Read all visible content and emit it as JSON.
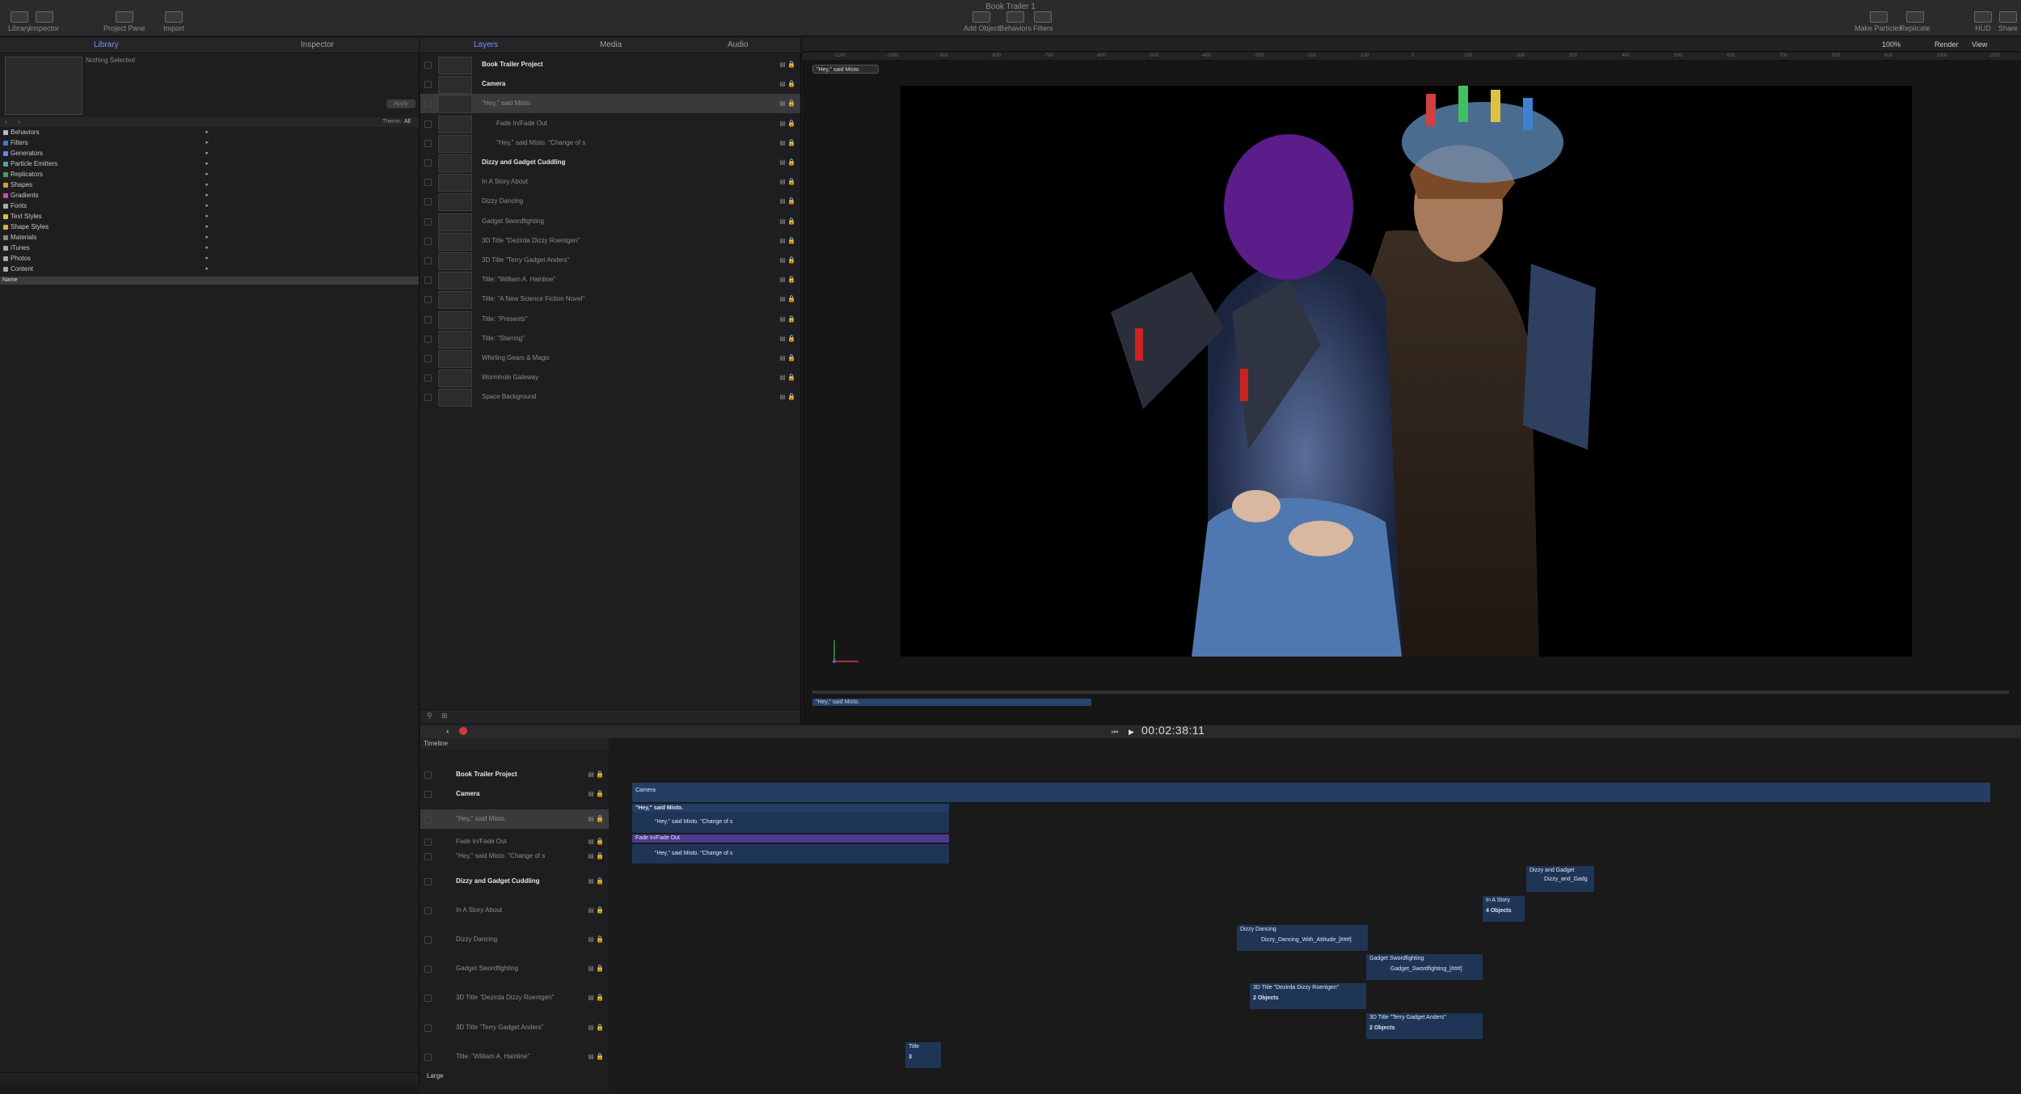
{
  "window": {
    "title": "Book Trailer 1"
  },
  "toolbar": {
    "left": [
      "Library",
      "Inspector",
      "Project Pane",
      "Import"
    ],
    "center": [
      "Add Object",
      "Behaviors",
      "Filters"
    ],
    "right": [
      "Make Particles",
      "Replicate",
      "HUD",
      "Share"
    ]
  },
  "left_tabs": {
    "library": "Library",
    "inspector": "Inspector"
  },
  "library": {
    "nothing_selected": "Nothing Selected",
    "apply": "Apply",
    "theme_label": "Theme:",
    "theme_value": "All",
    "categories": [
      {
        "label": "Behaviors",
        "color": "#bbbbbb"
      },
      {
        "label": "Filters",
        "color": "#3d7bd9"
      },
      {
        "label": "Generators",
        "color": "#5c8fe0"
      },
      {
        "label": "Particle Emitters",
        "color": "#4fa3a8"
      },
      {
        "label": "Replicators",
        "color": "#4a9c5a"
      },
      {
        "label": "Shapes",
        "color": "#d99a3d"
      },
      {
        "label": "Gradients",
        "color": "#c24cb1"
      },
      {
        "label": "Fonts",
        "color": "#aaaaaa"
      },
      {
        "label": "Text Styles",
        "color": "#d9c23d"
      },
      {
        "label": "Shape Styles",
        "color": "#d9b23d"
      },
      {
        "label": "Materials",
        "color": "#888888"
      },
      {
        "label": "iTunes",
        "color": "#aaaaaa"
      },
      {
        "label": "Photos",
        "color": "#aaaaaa"
      },
      {
        "label": "Content",
        "color": "#aaaaaa"
      }
    ],
    "name_header": "Name"
  },
  "middle_tabs": {
    "layers": "Layers",
    "media": "Media",
    "audio": "Audio"
  },
  "layers": [
    {
      "label": "Book Trailer Project",
      "bold": true,
      "indent": 0
    },
    {
      "label": "Camera",
      "bold": true,
      "indent": 0
    },
    {
      "label": "\"Hey,\" said Misto.",
      "bold": false,
      "indent": 0,
      "selected": true
    },
    {
      "label": "Fade In/Fade Out",
      "bold": false,
      "indent": 1
    },
    {
      "label": "\"Hey,\" said Misto. \"Change of s",
      "bold": false,
      "indent": 1
    },
    {
      "label": "Dizzy and Gadget Cuddling",
      "bold": true,
      "indent": 0
    },
    {
      "label": "In A Story About",
      "bold": false,
      "indent": 0
    },
    {
      "label": "Dizzy Dancing",
      "bold": false,
      "indent": 0
    },
    {
      "label": "Gadget Swordfighting",
      "bold": false,
      "indent": 0
    },
    {
      "label": "3D Title \"Dezirda Dizzy Roentgen\"",
      "bold": false,
      "indent": 0
    },
    {
      "label": "3D Title \"Terry Gadget Anders\"",
      "bold": false,
      "indent": 0
    },
    {
      "label": "Title: \"William A. Hainline\"",
      "bold": false,
      "indent": 0
    },
    {
      "label": "Title: \"A New Science Fiction Novel\"",
      "bold": false,
      "indent": 0
    },
    {
      "label": "Title: \"Presents\"",
      "bold": false,
      "indent": 0
    },
    {
      "label": "Title: \"Starring\"",
      "bold": false,
      "indent": 0
    },
    {
      "label": "Whirling Gears & Magic",
      "bold": false,
      "indent": 0
    },
    {
      "label": "Wormhole Gateway",
      "bold": false,
      "indent": 0
    },
    {
      "label": "Space Background",
      "bold": false,
      "indent": 0
    }
  ],
  "canvas": {
    "zoom": "100%",
    "render": "Render",
    "view": "View",
    "layer_popup": "\"Hey,\" said Misto.",
    "ruler_ticks": [
      "-1100",
      "-1000",
      "-900",
      "-800",
      "-700",
      "-600",
      "-500",
      "-400",
      "-300",
      "-200",
      "-100",
      "0",
      "100",
      "200",
      "300",
      "400",
      "500",
      "600",
      "700",
      "800",
      "900",
      "1000",
      "1100",
      "1200"
    ],
    "mini_timeline_label": "\"Hey,\" said Misto."
  },
  "timeline": {
    "title": "Timeline",
    "timecode": "00:02:38:11",
    "layers": [
      "Book Trailer Project",
      "Camera",
      "\"Hey,\" said Misto.",
      "Fade In/Fade Out",
      "\"Hey,\" said Misto. \"Change of s",
      "Dizzy and Gadget Cuddling",
      "In A Story About",
      "Dizzy Dancing",
      "Gadget Swordfighting",
      "3D Title \"Dezirda Dizzy Roentgen\"",
      "3D Title \"Terry Gadget Anders\"",
      "Title: \"William A. Hainline\""
    ],
    "bars": {
      "camera": "Camera",
      "hey_header": "\"Hey,\" said Misto.",
      "hey_sub": "\"Hey,\" said Misto. \"Change of s",
      "fade": "Fade In/Fade Out",
      "hey_sub2": "\"Hey,\" said Misto. \"Change of s",
      "dizzy_gadget": "Dizzy and Gadget",
      "dizzy_gadget_clip": "Dizzy_and_Gadg",
      "in_a_story": "In A Story",
      "in_a_story_count": "4 Objects",
      "dizzy_dancing": "Dizzy Dancing",
      "dizzy_dancing_clip": "Dizzy_Dancing_With_Attitude_[###]",
      "gadget_sword": "Gadget Swordfighting",
      "gadget_sword_clip": "Gadget_Swordfighting_[###]",
      "title_dezirda": "3D Title \"Dezirda Dizzy Roentgen\"",
      "title_dezirda_count": "2 Objects",
      "title_terry": "3D Title \"Terry Gadget Anders\"",
      "title_terry_count": "2 Objects",
      "title_small": "Title",
      "title_small_count": "3"
    },
    "size_label": "Large"
  }
}
